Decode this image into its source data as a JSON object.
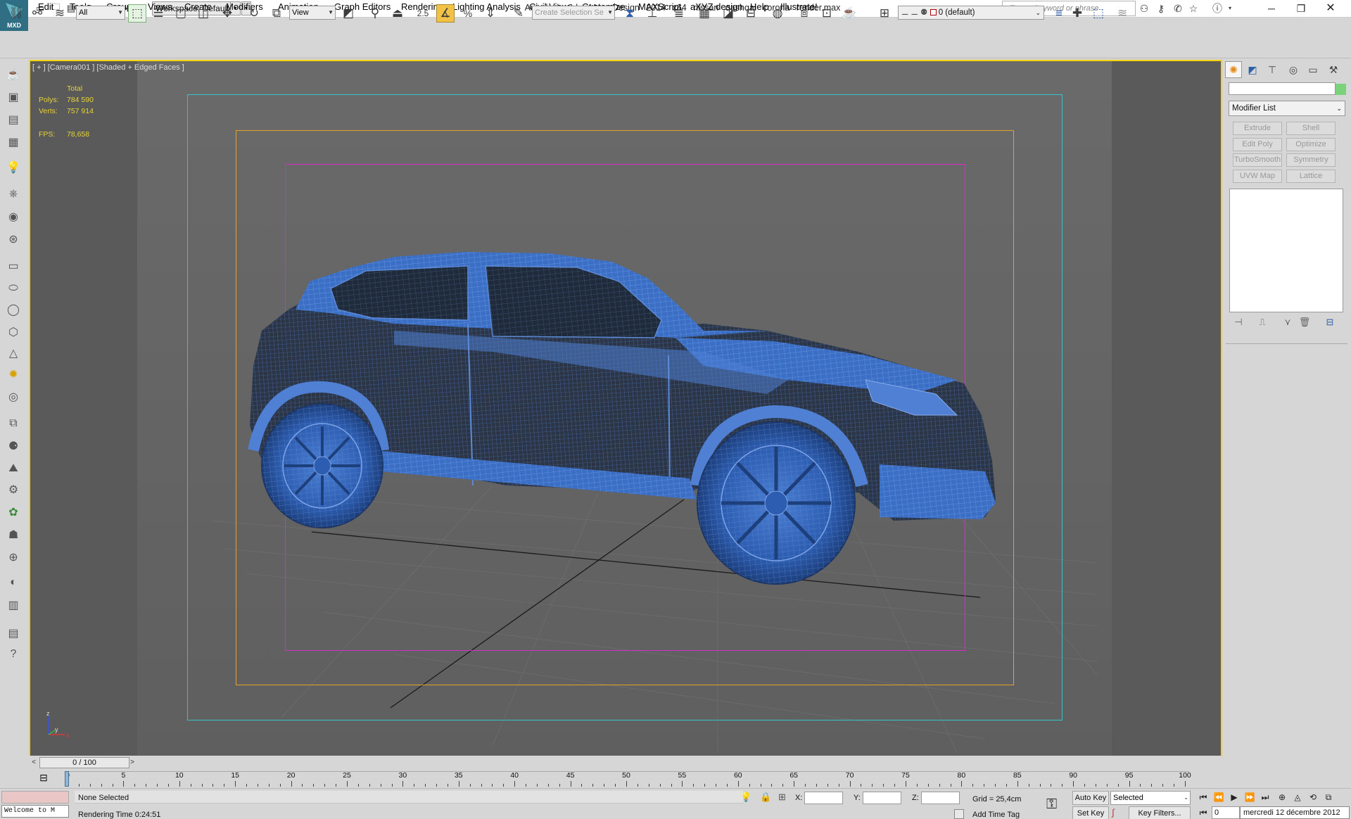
{
  "app": {
    "title": "Autodesk 3ds Max Design 2014 x64",
    "file_name": "nissan qashqai corona render.max",
    "logo_text": "MXD",
    "workspace": "Workspace: Default",
    "search_placeholder": "Type a keyword or phrase",
    "window_controls": [
      "minimize",
      "restore",
      "close"
    ]
  },
  "menu": [
    "Edit",
    "Tools",
    "Group",
    "Views",
    "Create",
    "Modifiers",
    "Animation",
    "Graph Editors",
    "Rendering",
    "Lighting Analysis",
    "Civil View",
    "Customize",
    "MAXScript",
    "aXYZ design",
    "Help",
    "Illustrate!"
  ],
  "toolbar": {
    "selection_filter": "All",
    "reference_coord": "View",
    "snap_value": "2.5",
    "selection_set_placeholder": "Create Selection Se",
    "layer_current": "0 (default)"
  },
  "viewport": {
    "label": "[ + ] [Camera001 ] [Shaded + Edged Faces ]",
    "stats": {
      "header": "Total",
      "polys_label": "Polys:",
      "polys": "784 590",
      "verts_label": "Verts:",
      "verts": "757 914",
      "fps_label": "FPS:",
      "fps": "78,658"
    },
    "axis_labels": {
      "z": "z",
      "y": "y",
      "x": "x"
    },
    "frame_colors": {
      "outer": "#32c4c8",
      "middle": "#e2a326",
      "inner": "#d72bd0",
      "active_border": "#f5d20f"
    },
    "wireframe_color": "#3d72c8"
  },
  "command_panel": {
    "modifier_list": "Modifier List",
    "buttons": [
      "Extrude",
      "Shell",
      "Edit Poly",
      "Optimize",
      "TurboSmooth",
      "Symmetry",
      "UVW Map",
      "Lattice"
    ]
  },
  "timeline": {
    "slider": "0 / 100",
    "ticks": [
      0,
      5,
      10,
      15,
      20,
      25,
      30,
      35,
      40,
      45,
      50,
      55,
      60,
      65,
      70,
      75,
      80,
      85,
      90,
      95,
      100
    ]
  },
  "status_bar": {
    "maxscript_text": "Welcome to M",
    "selection": "None Selected",
    "render_time": "Rendering Time  0:24:51",
    "x_label": "X:",
    "y_label": "Y:",
    "z_label": "Z:",
    "grid": "Grid = 25,4cm",
    "add_time_tag": "Add Time Tag",
    "auto_key": "Auto Key",
    "set_key": "Set Key",
    "selected_combo": "Selected",
    "key_filters": "Key Filters...",
    "frame_value": "0",
    "date_text": "mercredi 12 décembre 2012"
  }
}
